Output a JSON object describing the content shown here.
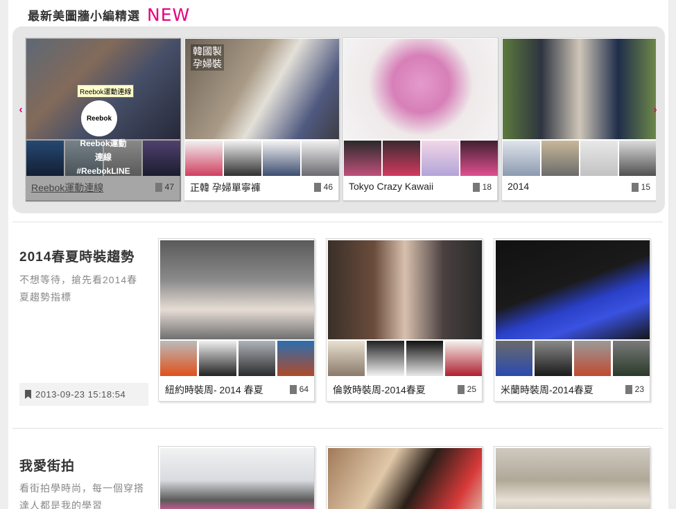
{
  "header": {
    "title": "最新美圖牆小編精選",
    "new_tag": "NEW"
  },
  "carousel": {
    "prev_icon": "‹",
    "next_icon": "›",
    "cards": [
      {
        "caption": "Reebok運動連線",
        "count": "47",
        "hovered": true,
        "tooltip": "Reebok運動連線",
        "logo_text": "Reebok",
        "overlay_text": "Reebok運動\n連線\n#ReebokLINE"
      },
      {
        "caption": "正韓 孕婦單寧褲",
        "count": "46",
        "badge": "韓國製\n孕婦裝"
      },
      {
        "caption": "Tokyo Crazy Kawaii",
        "count": "18"
      },
      {
        "caption": "2014",
        "count": "15"
      }
    ]
  },
  "sections": [
    {
      "title": "2014春夏時裝趨勢",
      "desc": "不想等待，搶先看2014春夏趨勢指標",
      "date": "2013-09-23 15:18:54",
      "cards": [
        {
          "caption": "紐約時裝周- 2014 春夏",
          "count": "64"
        },
        {
          "caption": "倫敦時裝周-2014春夏",
          "count": "25"
        },
        {
          "caption": "米蘭時裝周-2014春夏",
          "count": "23"
        }
      ]
    },
    {
      "title": "我愛街拍",
      "desc": "看街拍學時尚，每一個穿搭達人都是我的學習"
    }
  ],
  "colors": {
    "accent": "#e6007e"
  }
}
